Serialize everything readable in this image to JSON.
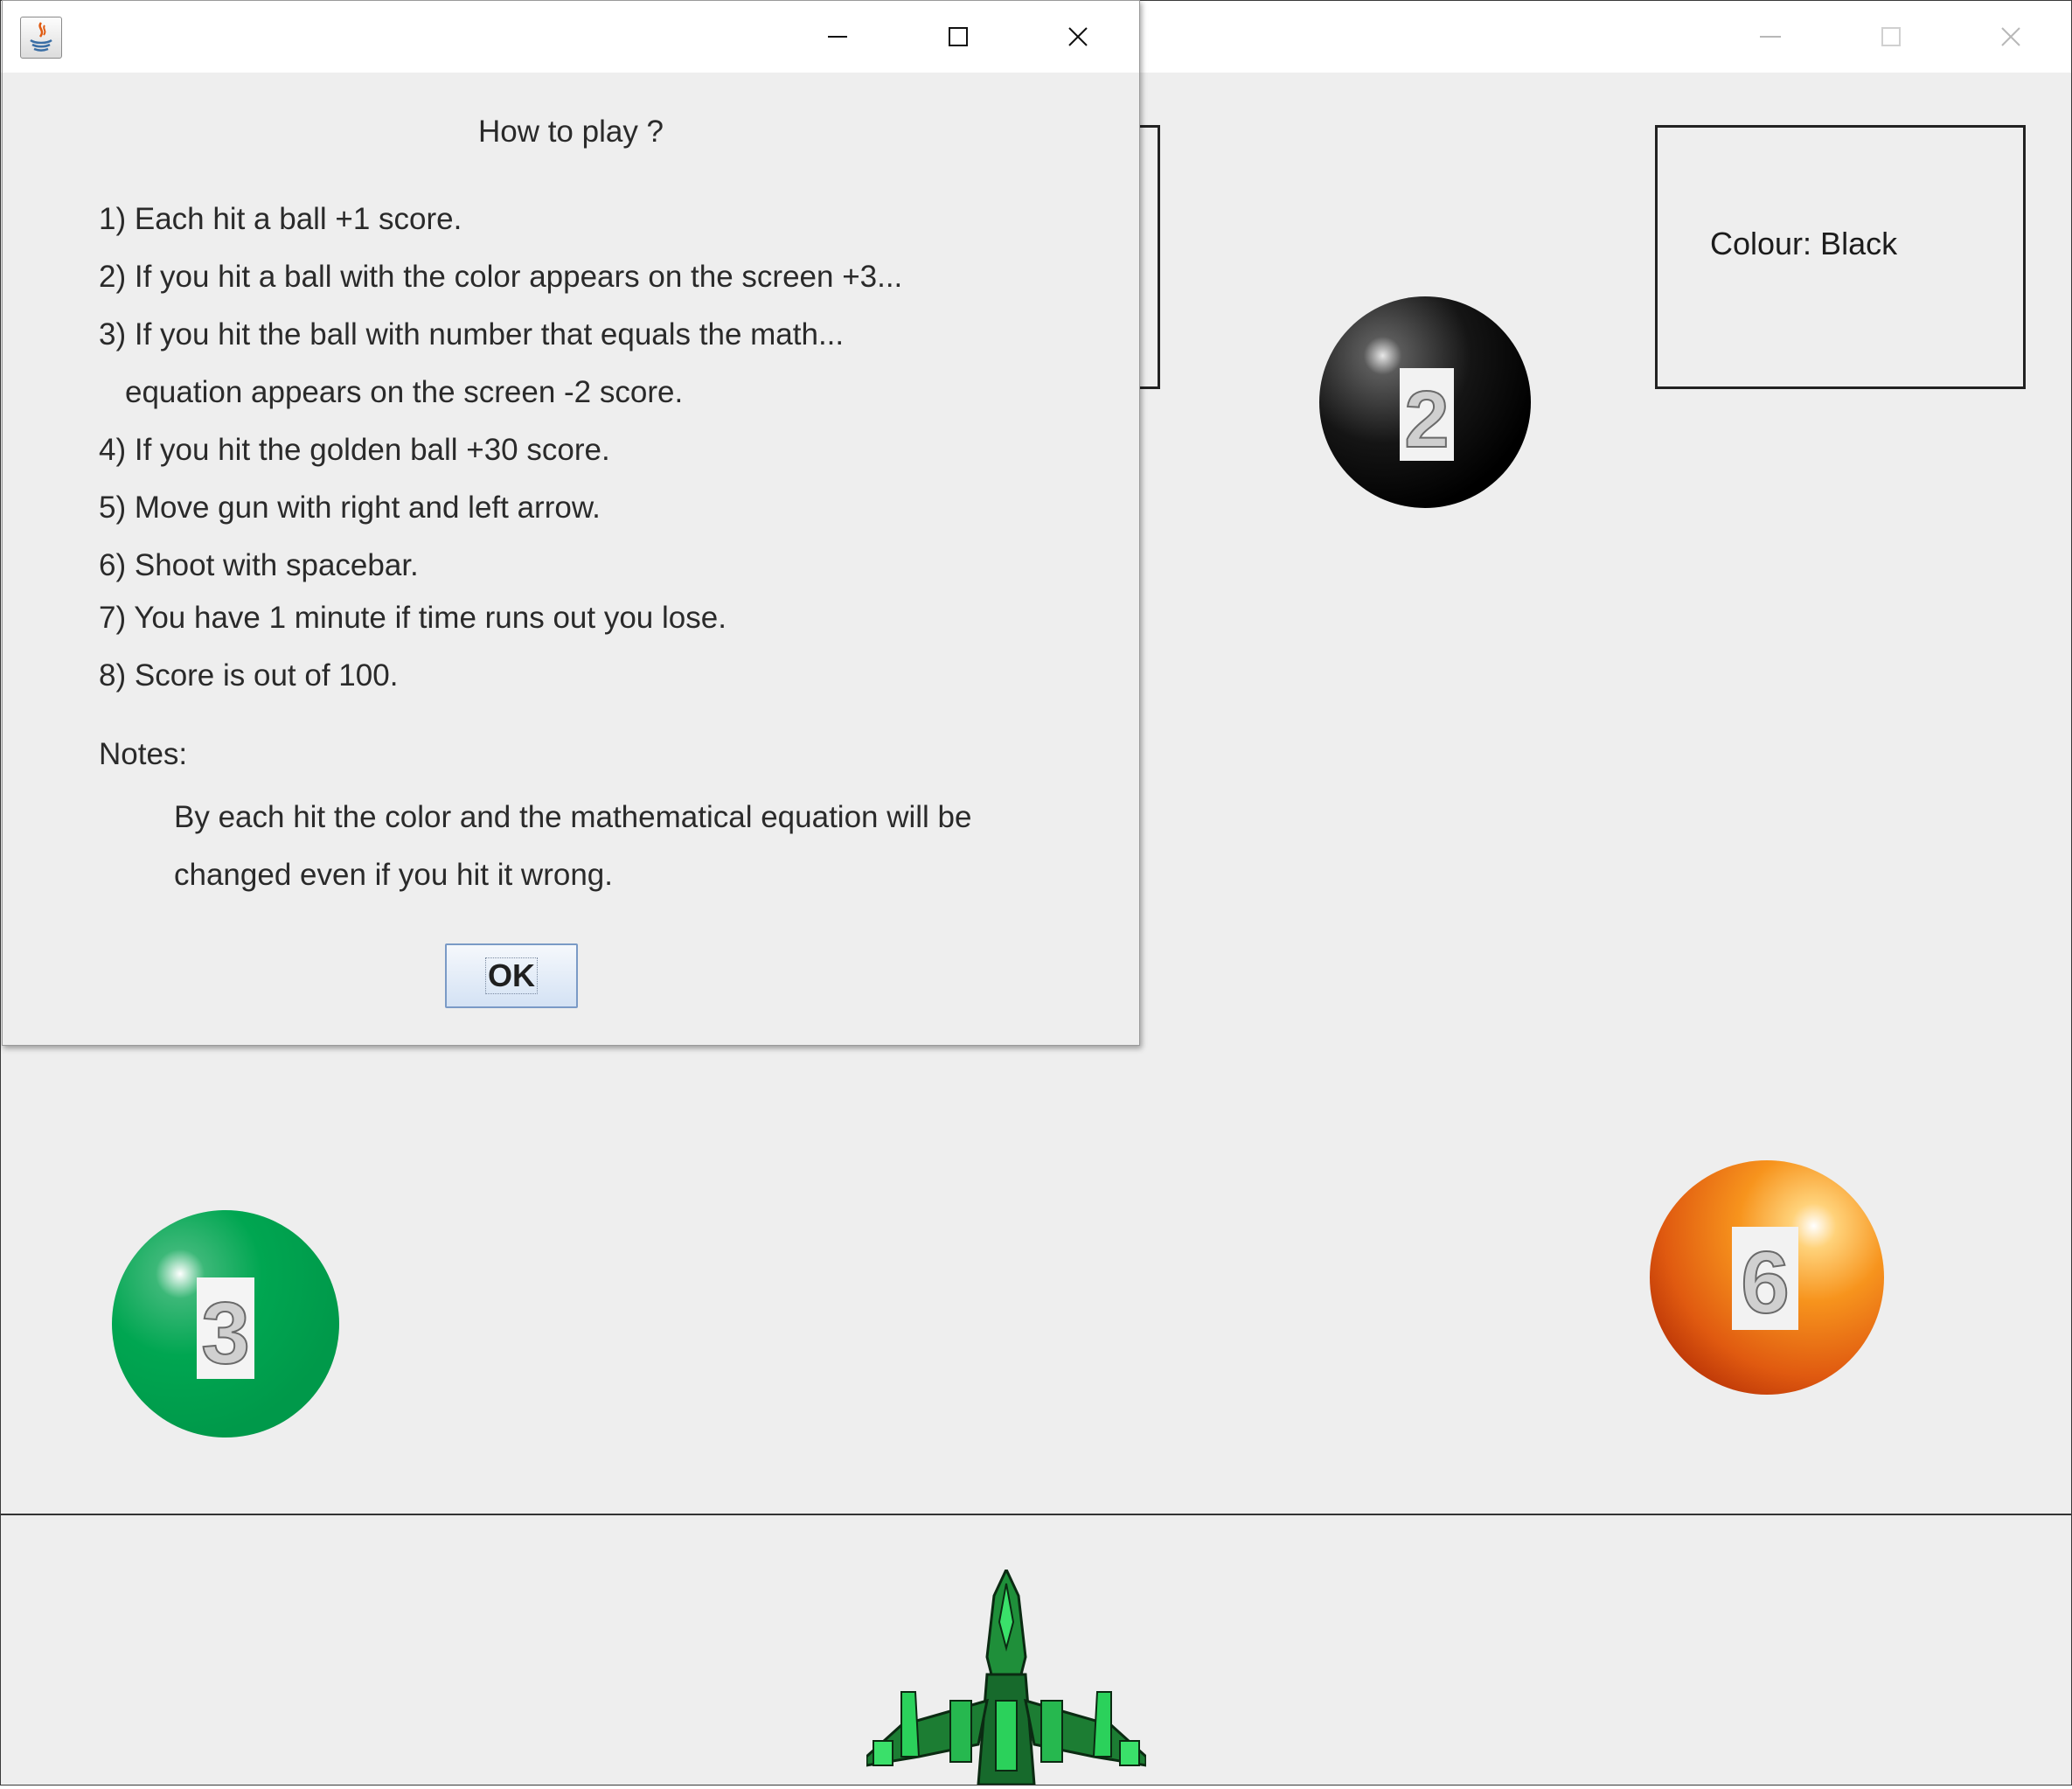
{
  "game": {
    "colour_text": "Colour: Black",
    "balls": [
      {
        "number": "2",
        "color": "#111111",
        "name": "black"
      },
      {
        "number": "3",
        "color": "#00a651",
        "name": "green"
      },
      {
        "number": "6",
        "color": "#f07a10",
        "name": "orange"
      }
    ],
    "ship_icon": "green-spaceship-icon"
  },
  "dialog": {
    "title": "How to play ?",
    "rules": [
      "1) Each hit a ball +1 score.",
      "2) If you hit a ball with the color appears on the screen +3...",
      "3) If you hit the ball with number that equals the math...",
      "equation appears on the screen -2 score.",
      "4) If you hit the golden ball +30 score.",
      "5) Move gun with right and left arrow.",
      "6) Shoot with spacebar.",
      "7) You have 1 minute if time runs out you lose.",
      "8) Score is out of 100."
    ],
    "notes_heading": "Notes:",
    "notes_lines": [
      "By each hit the color and the mathematical equation will be",
      "changed even if you hit it wrong."
    ],
    "ok_label": "OK"
  },
  "colors": {
    "background": "#eeeeee",
    "ok_button_border": "#7a9ac6"
  },
  "icons": [
    "java-icon",
    "minimize-icon",
    "maximize-icon",
    "close-icon"
  ]
}
